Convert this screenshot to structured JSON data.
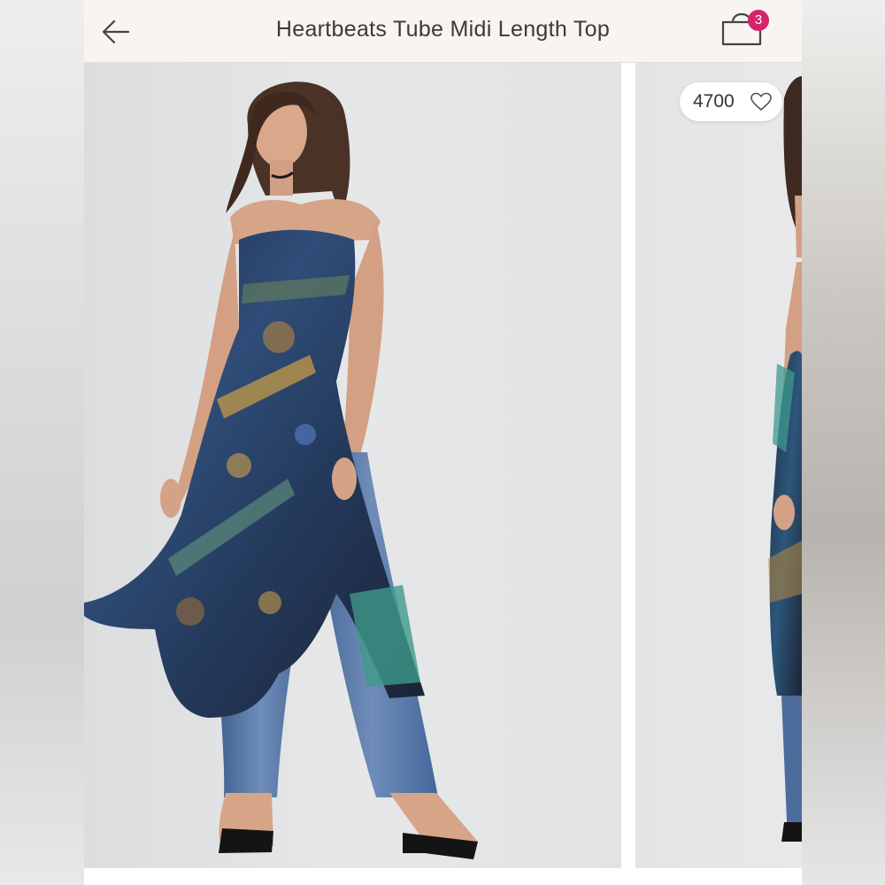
{
  "header": {
    "title": "Heartbeats Tube Midi Length Top",
    "back_icon": "arrow-left-icon",
    "cart_icon": "shopping-bag-icon",
    "cart_count": "3"
  },
  "gallery": {
    "photos": [
      {
        "name": "product-photo-front"
      },
      {
        "name": "product-photo-side"
      }
    ],
    "likes": "4700",
    "like_icon": "heart-outline-icon"
  },
  "colors": {
    "header_bg": "#f7f4f2",
    "badge": "#d6226d",
    "photo_bg": "#e4e5e7"
  }
}
